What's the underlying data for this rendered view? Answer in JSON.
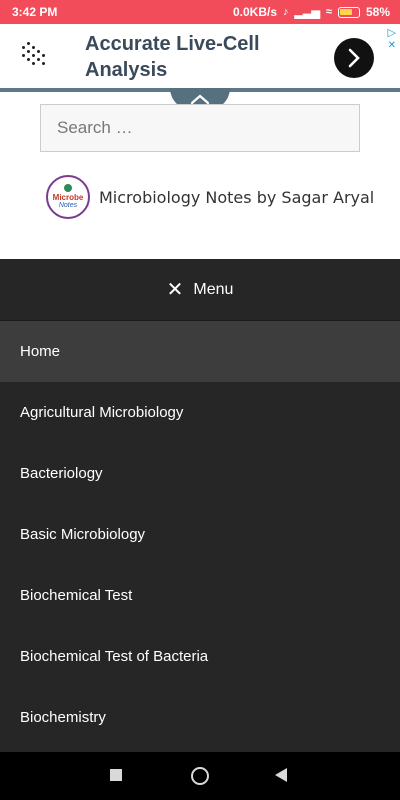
{
  "status_bar": {
    "time": "3:42 PM",
    "network_speed": "0.0KB/s",
    "battery": "58%"
  },
  "ad": {
    "headline": "Accurate Live-Cell Analysis",
    "arrow_icon": "chevron-right-icon"
  },
  "search": {
    "placeholder": "Search …"
  },
  "brand": {
    "badge_line1": "Microbe",
    "badge_line2": "Notes",
    "name": "Microbiology Notes by Sagar Aryal"
  },
  "menu": {
    "label": "Menu",
    "close_icon": "close-icon",
    "items": [
      {
        "label": "Home",
        "active": true
      },
      {
        "label": "Agricultural Microbiology"
      },
      {
        "label": "Bacteriology"
      },
      {
        "label": "Basic Microbiology"
      },
      {
        "label": "Biochemical Test"
      },
      {
        "label": "Biochemical Test of Bacteria"
      },
      {
        "label": "Biochemistry"
      }
    ]
  },
  "colors": {
    "status_bar": "#f24c5a",
    "menu_bg": "#262626",
    "menu_active_bg": "#3d3d3d",
    "ad_headline": "#3b4a5a"
  }
}
